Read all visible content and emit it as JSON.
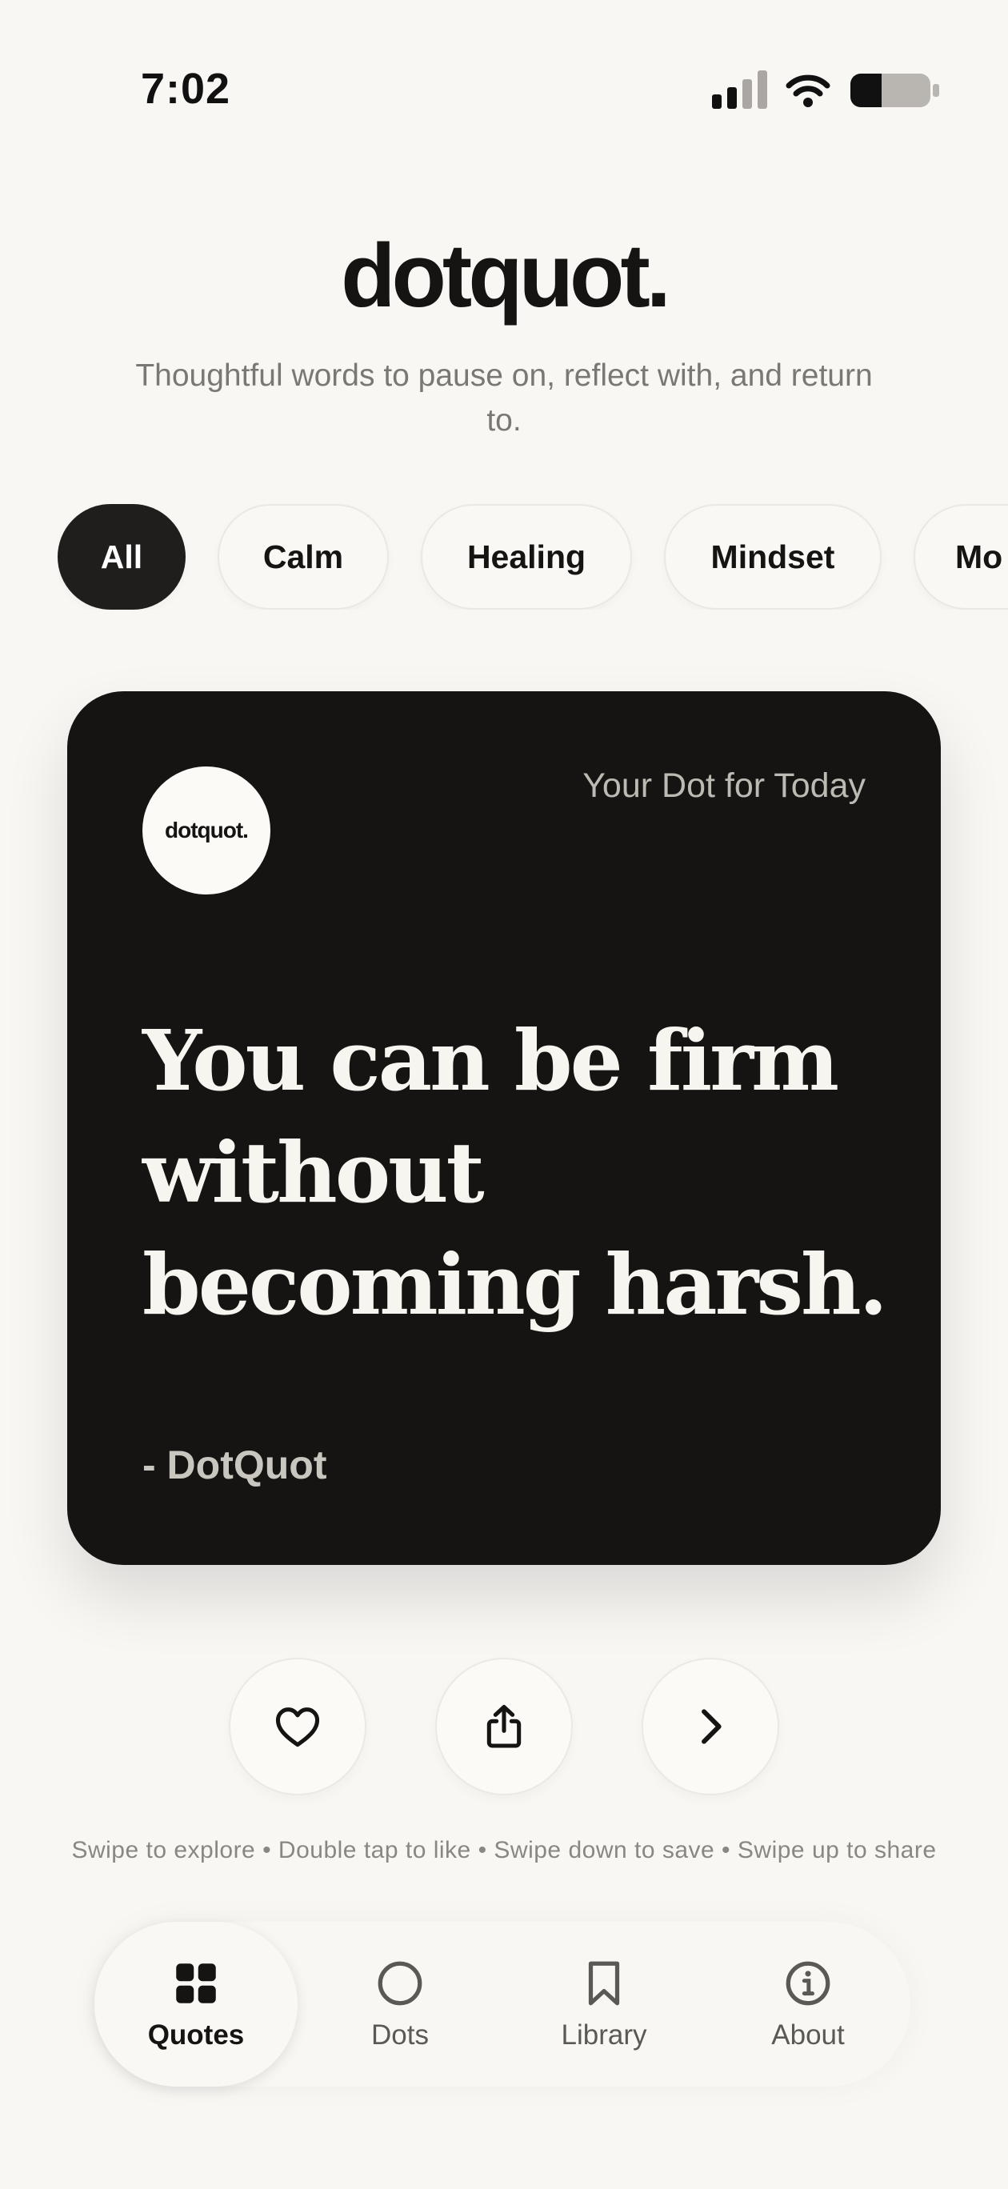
{
  "status_bar": {
    "time": "7:02"
  },
  "header": {
    "brand": "dotquot",
    "brand_dot": ".",
    "tagline": "Thoughtful words to pause on, reflect with, and return to."
  },
  "categories": [
    {
      "label": "All",
      "active": true
    },
    {
      "label": "Calm",
      "active": false
    },
    {
      "label": "Healing",
      "active": false
    },
    {
      "label": "Mindset",
      "active": false
    },
    {
      "label": "Mo",
      "active": false
    }
  ],
  "card": {
    "badge": "dotquot.",
    "label": "Your Dot for Today",
    "quote": "You can be firm without becoming harsh.",
    "author": "- DotQuot"
  },
  "actions": [
    {
      "icon": "heart-icon"
    },
    {
      "icon": "share-icon"
    },
    {
      "icon": "chevron-right-icon"
    }
  ],
  "hint": "Swipe to explore • Double tap to like • Swipe down to save • Swipe up to share",
  "tabs": [
    {
      "label": "Quotes",
      "icon": "grid-icon",
      "active": true
    },
    {
      "label": "Dots",
      "icon": "circle-icon",
      "active": false
    },
    {
      "label": "Library",
      "icon": "bookmark-icon",
      "active": false
    },
    {
      "label": "About",
      "icon": "info-icon",
      "active": false
    }
  ],
  "colors": {
    "background": "#f8f7f4",
    "card": "#151413",
    "accent": "#1f1e1c",
    "muted_text": "#7b7874"
  }
}
